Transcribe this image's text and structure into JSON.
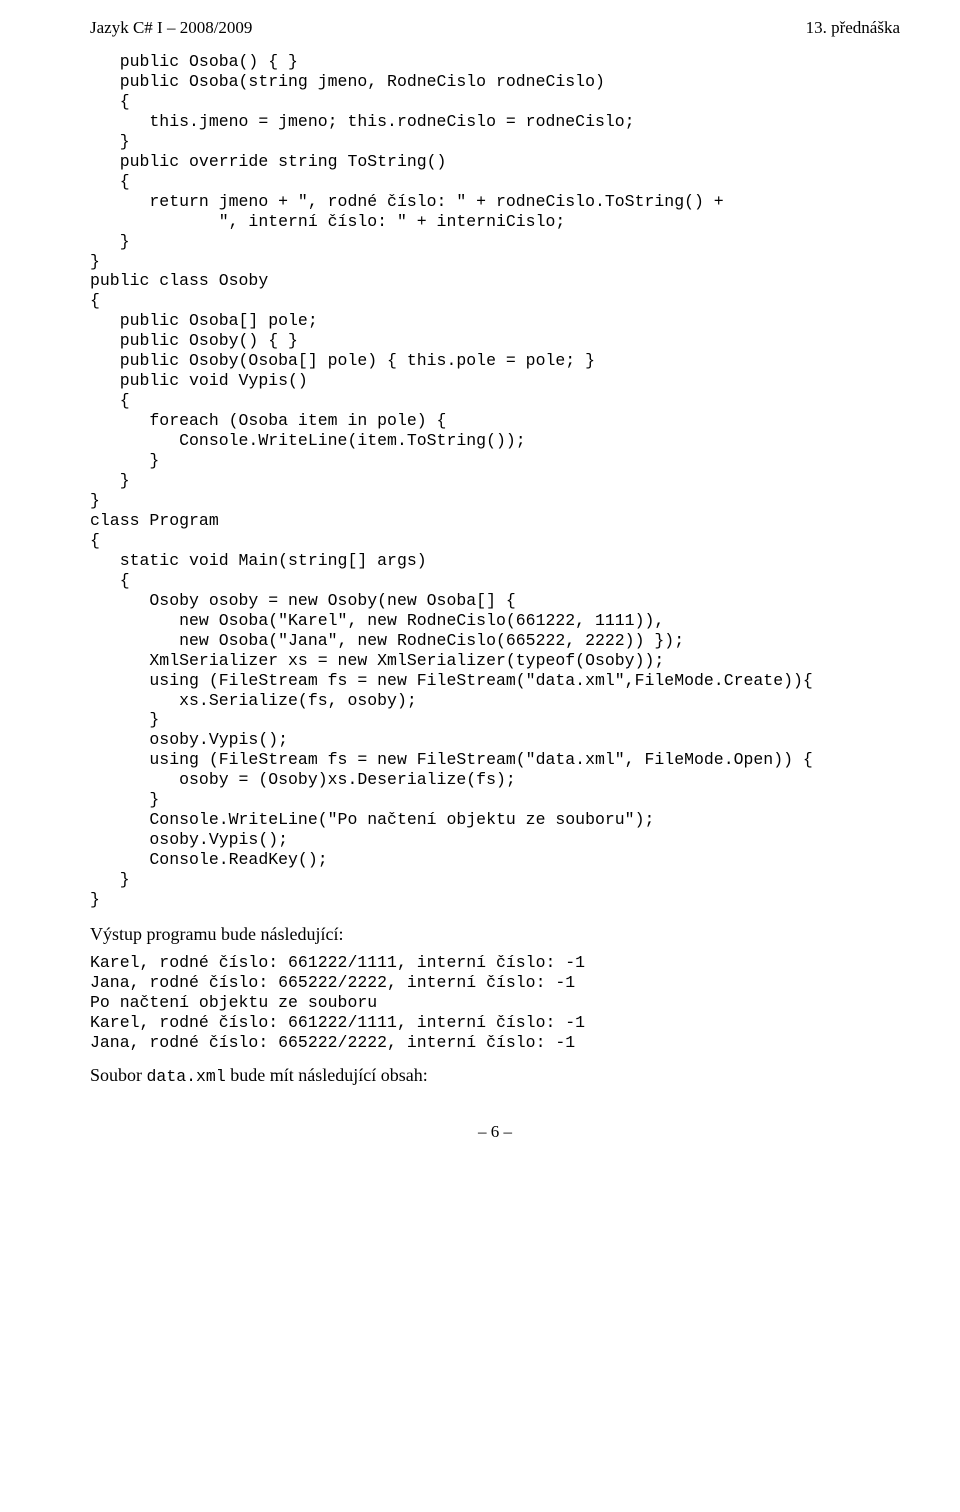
{
  "header": {
    "left": "Jazyk C# I – 2008/2009",
    "right": "13. přednáška"
  },
  "code_block": "   public Osoba() { }\n   public Osoba(string jmeno, RodneCislo rodneCislo)\n   {\n      this.jmeno = jmeno; this.rodneCislo = rodneCislo;\n   }\n   public override string ToString()\n   {\n      return jmeno + \", rodné číslo: \" + rodneCislo.ToString() +\n             \", interní číslo: \" + interniCislo;\n   }\n}\npublic class Osoby\n{\n   public Osoba[] pole;\n   public Osoby() { }\n   public Osoby(Osoba[] pole) { this.pole = pole; }\n   public void Vypis()\n   {\n      foreach (Osoba item in pole) {\n         Console.WriteLine(item.ToString());\n      }\n   }\n}\nclass Program\n{\n   static void Main(string[] args)\n   {\n      Osoby osoby = new Osoby(new Osoba[] {\n         new Osoba(\"Karel\", new RodneCislo(661222, 1111)),\n         new Osoba(\"Jana\", new RodneCislo(665222, 2222)) });\n      XmlSerializer xs = new XmlSerializer(typeof(Osoby));\n      using (FileStream fs = new FileStream(\"data.xml\",FileMode.Create)){\n         xs.Serialize(fs, osoby);\n      }\n      osoby.Vypis();\n      using (FileStream fs = new FileStream(\"data.xml\", FileMode.Open)) {\n         osoby = (Osoby)xs.Deserialize(fs);\n      }\n      Console.WriteLine(\"Po načtení objektu ze souboru\");\n      osoby.Vypis();\n      Console.ReadKey();\n   }\n}",
  "para1": "Výstup programu bude následující:",
  "output_block": "Karel, rodné číslo: 661222/1111, interní číslo: -1\nJana, rodné číslo: 665222/2222, interní číslo: -1\nPo načtení objektu ze souboru\nKarel, rodné číslo: 661222/1111, interní číslo: -1\nJana, rodné číslo: 665222/2222, interní číslo: -1",
  "para2_prefix": "Soubor ",
  "para2_mono": "data.xml",
  "para2_suffix": " bude mít následující obsah:",
  "pagenum": "– 6 –"
}
